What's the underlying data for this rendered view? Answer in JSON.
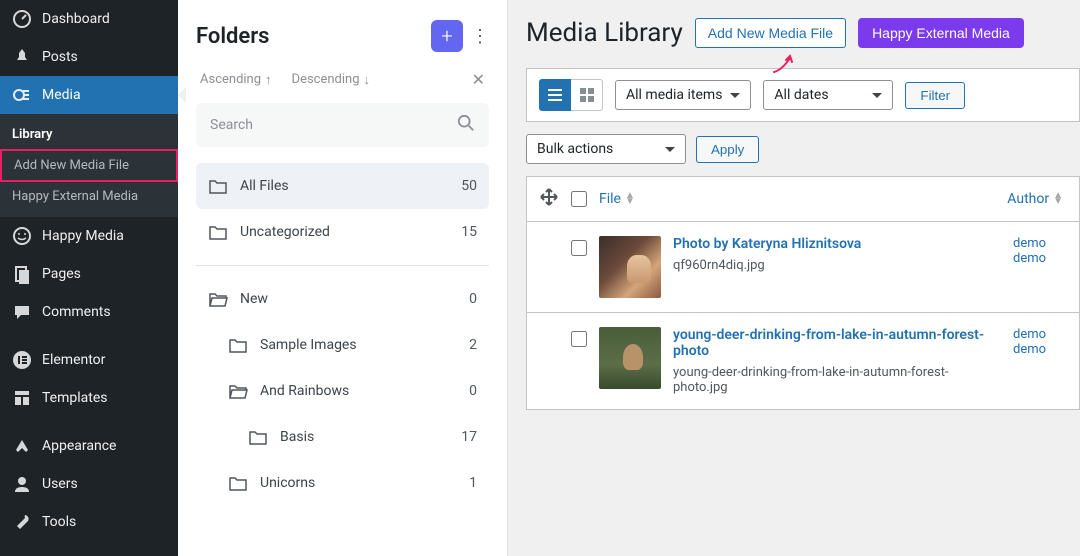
{
  "sidebar": {
    "items": [
      {
        "label": "Dashboard",
        "icon": "dashboard"
      },
      {
        "label": "Posts",
        "icon": "pin"
      },
      {
        "label": "Media",
        "icon": "media",
        "active": true,
        "submenu": [
          {
            "label": "Library",
            "active": true
          },
          {
            "label": "Add New Media File",
            "highlighted": true
          },
          {
            "label": "Happy External Media"
          }
        ]
      },
      {
        "label": "Happy Media",
        "icon": "happy"
      },
      {
        "label": "Pages",
        "icon": "pages"
      },
      {
        "label": "Comments",
        "icon": "comments"
      },
      {
        "label": "Elementor",
        "icon": "elementor"
      },
      {
        "label": "Templates",
        "icon": "templates"
      },
      {
        "label": "Appearance",
        "icon": "appearance"
      },
      {
        "label": "Users",
        "icon": "users"
      },
      {
        "label": "Tools",
        "icon": "tools"
      }
    ]
  },
  "folders": {
    "title": "Folders",
    "sort_ascending": "Ascending",
    "sort_descending": "Descending",
    "search_placeholder": "Search",
    "items": [
      {
        "name": "All Files",
        "count": 50,
        "selected": true
      },
      {
        "name": "Uncategorized",
        "count": 15
      }
    ],
    "tree": [
      {
        "name": "New",
        "count": 0,
        "indent": 0,
        "open": true
      },
      {
        "name": "Sample Images",
        "count": 2,
        "indent": 1
      },
      {
        "name": "And Rainbows",
        "count": 0,
        "indent": 1,
        "open": true
      },
      {
        "name": "Basis",
        "count": 17,
        "indent": 2
      },
      {
        "name": "Unicorns",
        "count": 1,
        "indent": 1
      }
    ]
  },
  "main": {
    "title": "Media Library",
    "add_new_btn": "Add New Media File",
    "external_btn": "Happy External Media",
    "media_items_select": "All media items",
    "dates_select": "All dates",
    "filter_btn": "Filter",
    "bulk_select": "Bulk actions",
    "apply_btn": "Apply",
    "col_file": "File",
    "col_author": "Author",
    "rows": [
      {
        "title": "Photo by Kateryna Hliznitsova",
        "filename": "qf960rn4diq.jpg",
        "author": "demo",
        "author2": "demo"
      },
      {
        "title": "young-deer-drinking-from-lake-in-autumn-forest-photo",
        "filename": "young-deer-drinking-from-lake-in-autumn-forest-photo.jpg",
        "author": "demo",
        "author2": "demo"
      }
    ]
  }
}
